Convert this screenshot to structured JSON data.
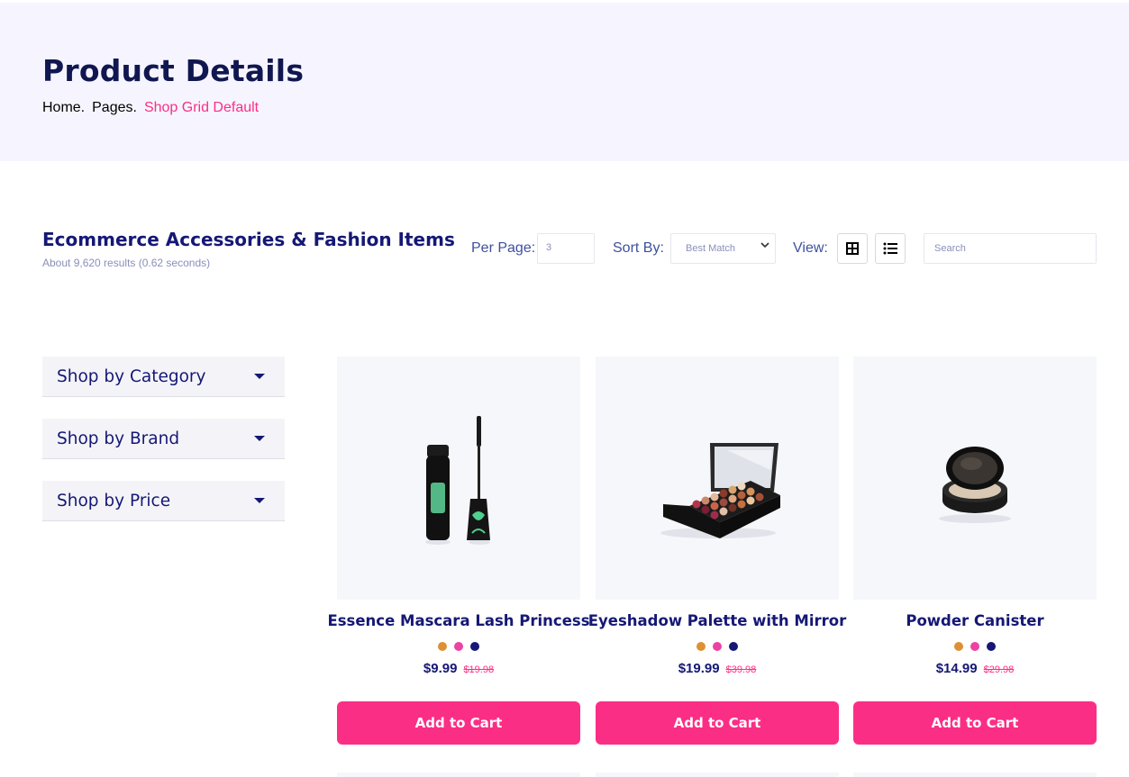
{
  "hero": {
    "title": "Product Details",
    "breadcrumbs": [
      "Home.",
      "Pages.",
      "Shop Grid Default"
    ]
  },
  "toolbar": {
    "title": "Ecommerce Accessories & Fashion Items",
    "subtitle": "About 9,620 results (0.62 seconds)",
    "per_page_label": "Per Page:",
    "per_page_value": "3",
    "sort_label": "Sort By:",
    "sort_value": "Best Match",
    "view_label": "View:",
    "search_placeholder": "Search"
  },
  "filters": [
    {
      "label": "Shop by Category"
    },
    {
      "label": "Shop by Brand"
    },
    {
      "label": "Shop by Price"
    }
  ],
  "products": [
    {
      "name": "Essence Mascara Lash Princess",
      "price": "$9.99",
      "old_price": "$19.98",
      "cta": "Add to Cart",
      "image": "mascara"
    },
    {
      "name": "Eyeshadow Palette with Mirror",
      "price": "$19.99",
      "old_price": "$39.98",
      "cta": "Add to Cart",
      "image": "eyeshadow-palette"
    },
    {
      "name": "Powder Canister",
      "price": "$14.99",
      "old_price": "$29.98",
      "cta": "Add to Cart",
      "image": "powder-compact"
    }
  ],
  "swatches": [
    "#de9034",
    "#ec42a2",
    "#151875"
  ],
  "colors": {
    "accent": "#fb2e86",
    "navy": "#151875",
    "hero_bg": "#f6f5ff"
  }
}
